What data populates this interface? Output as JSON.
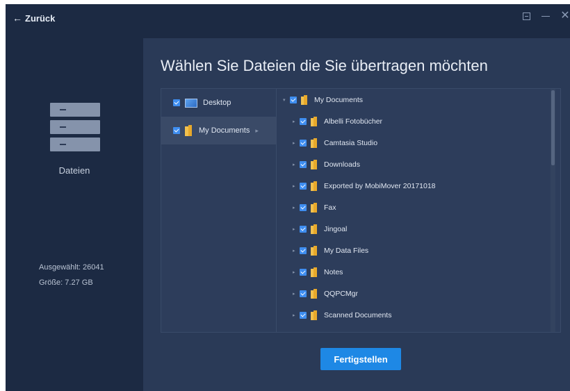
{
  "titlebar": {
    "back_label": "Zurück",
    "controls": [
      "menu-icon",
      "minimize-icon",
      "close-icon"
    ]
  },
  "sidebar": {
    "category_label": "Dateien",
    "selected_label": "Ausgewählt:",
    "selected_count": "26041",
    "size_label": "Größe:",
    "size_value": "7.27 GB"
  },
  "main": {
    "heading": "Wählen Sie Dateien die Sie übertragen möchten",
    "locations": [
      {
        "label": "Desktop",
        "checked": true,
        "icon": "desktop-icon"
      },
      {
        "label": "My Documents",
        "checked": true,
        "icon": "folder-icon",
        "selected": true
      }
    ],
    "tree_root": {
      "label": "My Documents",
      "checked": true
    },
    "tree_children": [
      {
        "label": "Albelli Fotobücher",
        "checked": true
      },
      {
        "label": "Camtasia Studio",
        "checked": true
      },
      {
        "label": "Downloads",
        "checked": true
      },
      {
        "label": "Exported by MobiMover 20171018",
        "checked": true
      },
      {
        "label": "Fax",
        "checked": true
      },
      {
        "label": "Jingoal",
        "checked": true
      },
      {
        "label": "My Data Files",
        "checked": true
      },
      {
        "label": "Notes",
        "checked": true
      },
      {
        "label": "QQPCMgr",
        "checked": true
      },
      {
        "label": "Scanned Documents",
        "checked": true
      }
    ],
    "finish_label": "Fertigstellen"
  },
  "colors": {
    "window_bg": "#1c2a43",
    "main_bg": "#2a3a57",
    "accent": "#1e88e5",
    "checkbox": "#3f8ef0",
    "folder": "#f2c14e"
  }
}
